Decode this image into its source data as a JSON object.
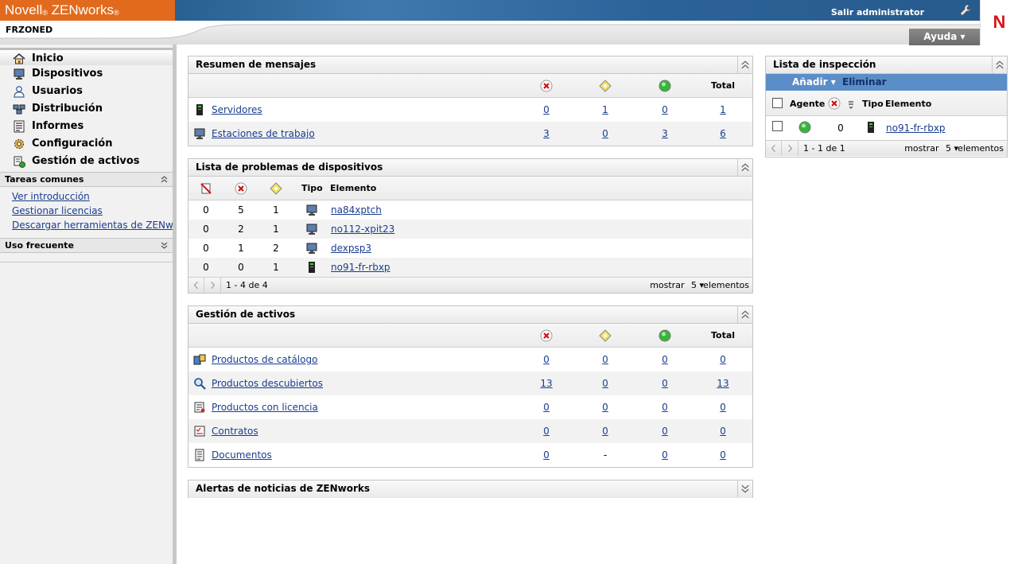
{
  "header": {
    "brand": "Novell",
    "brand_mark": "®",
    "product": "ZENworks",
    "product_mark": "®",
    "zone": "FRZONED",
    "logout": "Salir administrator",
    "help": "Ayuda",
    "help_arrow": "▾",
    "logo_letter": "N"
  },
  "nav": {
    "items": [
      {
        "label": "Inicio"
      },
      {
        "label": "Dispositivos"
      },
      {
        "label": "Usuarios"
      },
      {
        "label": "Distribución"
      },
      {
        "label": "Informes"
      },
      {
        "label": "Configuración"
      },
      {
        "label": "Gestión de activos"
      }
    ],
    "tasks_title": "Tareas comunes",
    "tasks": [
      {
        "label": "Ver introducción"
      },
      {
        "label": "Gestionar licencias"
      },
      {
        "label": "Descargar herramientas de ZENworks"
      }
    ],
    "frequent_title": "Uso frecuente"
  },
  "messages": {
    "title": "Resumen de mensajes",
    "total_label": "Total",
    "rows": [
      {
        "label": "Servidores",
        "critical": "0",
        "warning": "1",
        "normal": "0",
        "total": "1"
      },
      {
        "label": "Estaciones de trabajo",
        "critical": "3",
        "warning": "0",
        "normal": "3",
        "total": "6"
      }
    ]
  },
  "problems": {
    "title": "Lista de problemas de dispositivos",
    "type_label": "Tipo",
    "element_label": "Elemento",
    "rows": [
      {
        "a": "0",
        "b": "5",
        "c": "1",
        "name": "na84xptch"
      },
      {
        "a": "0",
        "b": "2",
        "c": "1",
        "name": "no112-xpit23"
      },
      {
        "a": "0",
        "b": "1",
        "c": "2",
        "name": "dexpsp3"
      },
      {
        "a": "0",
        "b": "0",
        "c": "1",
        "name": "no91-fr-rbxp"
      }
    ],
    "pager_range": "1 - 4 de 4",
    "pager_show": "mostrar",
    "pager_size": "5",
    "pager_items": "elementos"
  },
  "assets": {
    "title": "Gestión de activos",
    "total_label": "Total",
    "rows": [
      {
        "label": "Productos de catálogo",
        "critical": "0",
        "warning": "0",
        "normal": "0",
        "total": "0"
      },
      {
        "label": "Productos descubiertos",
        "critical": "13",
        "warning": "0",
        "normal": "0",
        "total": "13"
      },
      {
        "label": "Productos con licencia",
        "critical": "0",
        "warning": "0",
        "normal": "0",
        "total": "0"
      },
      {
        "label": "Contratos",
        "critical": "0",
        "warning": "0",
        "normal": "0",
        "total": "0"
      },
      {
        "label": "Documentos",
        "critical": "0",
        "warning": "-",
        "normal": "0",
        "total": "0"
      }
    ]
  },
  "news": {
    "title": "Alertas de noticias de ZENworks"
  },
  "watch": {
    "title": "Lista de inspección",
    "add": "Añadir",
    "add_arrow": "▾",
    "remove": "Eliminar",
    "col_agent": "Agente",
    "col_type": "Tipo",
    "col_element": "Elemento",
    "rows": [
      {
        "count": "0",
        "name": "no91-fr-rbxp"
      }
    ],
    "pager_range": "1 - 1 de 1",
    "pager_show": "mostrar",
    "pager_size": "5",
    "pager_items": "elementos"
  }
}
